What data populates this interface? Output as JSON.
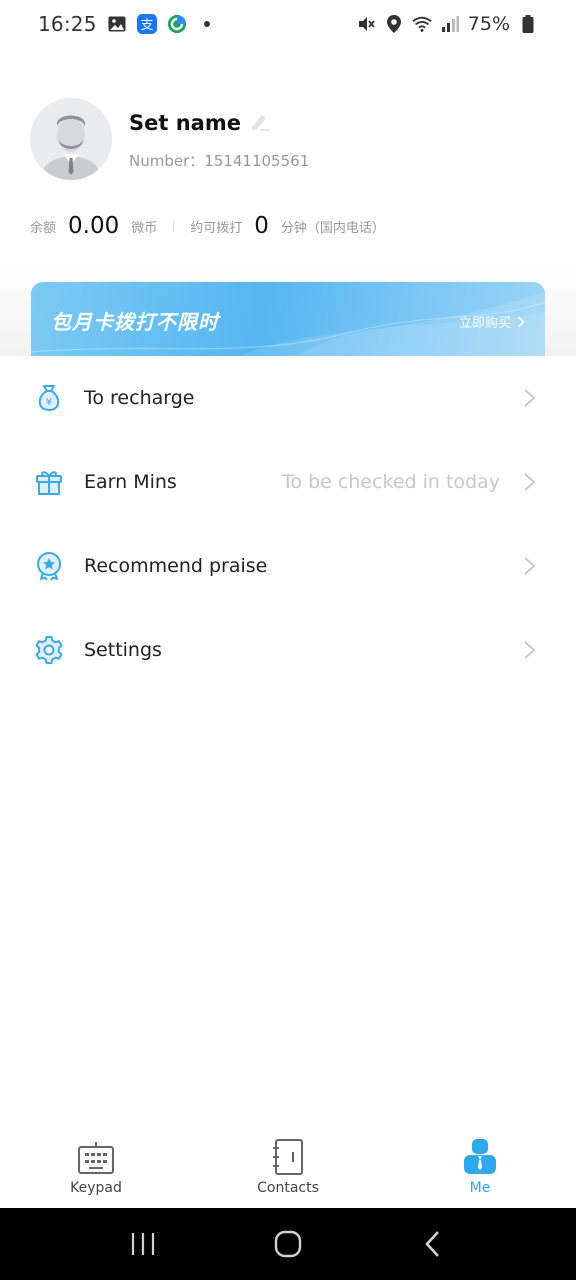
{
  "status_bar": {
    "time": "16:25",
    "battery": "75%"
  },
  "profile": {
    "name": "Set name",
    "number": "Number：15141105561"
  },
  "balance": {
    "balance_label": "余额",
    "balance_value": "0.00",
    "balance_unit": "微币",
    "callable_label": "约可拨打",
    "callable_value": "0",
    "callable_unit": "分钟（国内电话）"
  },
  "banner": {
    "title": "包月卡拨打不限时",
    "buy_label": "立即购买",
    "accent": "#55b6f0"
  },
  "menu": {
    "items": [
      {
        "label": "To recharge",
        "icon": "money-bag-icon",
        "hint": ""
      },
      {
        "label": "Earn Mins",
        "icon": "gift-icon",
        "hint": "To be checked in today"
      },
      {
        "label": "Recommend praise",
        "icon": "badge-star-icon",
        "hint": ""
      },
      {
        "label": "Settings",
        "icon": "gear-icon",
        "hint": ""
      }
    ]
  },
  "tabs": {
    "items": [
      {
        "label": "Keypad",
        "icon": "keypad-icon",
        "active": false
      },
      {
        "label": "Contacts",
        "icon": "contacts-book-icon",
        "active": false
      },
      {
        "label": "Me",
        "icon": "person-icon",
        "active": true
      }
    ],
    "active_color": "#2ea8ee"
  },
  "system_nav": {
    "buttons": [
      "recents-icon",
      "home-icon",
      "back-icon"
    ]
  }
}
